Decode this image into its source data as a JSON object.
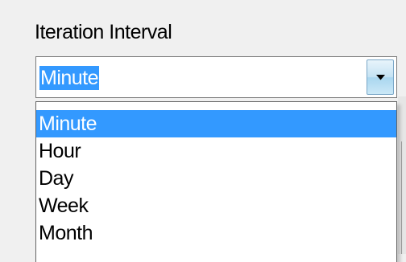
{
  "field": {
    "label": "Iteration Interval",
    "selected_value": "Minute"
  },
  "dropdown": {
    "options": [
      "Minute",
      "Hour",
      "Day",
      "Week",
      "Month"
    ],
    "highlighted_index": 0
  },
  "colors": {
    "highlight": "#3399ff",
    "highlight_text": "#ffffff"
  },
  "icons": {
    "combo_arrow": "chevron-down-icon"
  }
}
